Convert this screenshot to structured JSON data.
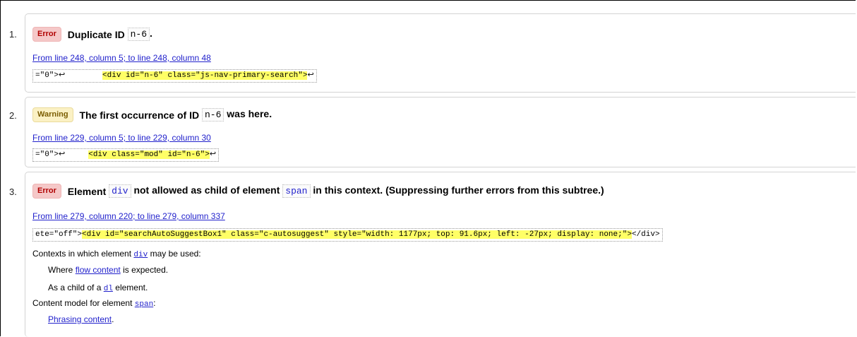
{
  "messages": [
    {
      "number": "1.",
      "type": "Error",
      "title_prefix": "Duplicate ID",
      "title_code": "n-6",
      "title_suffix": ".",
      "location": "From line 248, column 5; to line 248, column 48",
      "extract_pre": "=\"0\">↩        ",
      "extract_hl": "<div id=\"n-6\" class=\"js-nav-primary-search\">",
      "extract_post": "↩"
    },
    {
      "number": "2.",
      "type": "Warning",
      "title_prefix": "The first occurrence of ID",
      "title_code": "n-6",
      "title_suffix": "was here.",
      "location": "From line 229, column 5; to line 229, column 30",
      "extract_pre": "=\"0\">↩     ",
      "extract_hl": "<div class=\"mod\" id=\"n-6\">",
      "extract_post": "↩"
    },
    {
      "number": "3.",
      "type": "Error",
      "title_prefix": "Element",
      "title_code1": "div",
      "title_mid": "not allowed as child of element",
      "title_code2": "span",
      "title_suffix": "in this context. (Suppressing further errors from this subtree.)",
      "location": "From line 279, column 220; to line 279, column 337",
      "extract_pre": "ete=\"off\">",
      "extract_hl": "<div id=\"searchAutoSuggestBox1\" class=\"c-autosuggest\" style=\"width: 1177px; top: 91.6px; left: -27px; display: none;\">",
      "extract_post": "</div>",
      "contexts_label_pre": "Contexts in which element",
      "contexts_code": "div",
      "contexts_label_post": "may be used:",
      "context_1_pre": "Where",
      "context_1_link": "flow content",
      "context_1_post": "is expected.",
      "context_2_pre": "As a child of a",
      "context_2_code": "dl",
      "context_2_post": "element.",
      "content_model_pre": "Content model for element",
      "content_model_code": "span",
      "content_model_post": ":",
      "content_model_link": "Phrasing content",
      "content_model_link_post": "."
    }
  ]
}
